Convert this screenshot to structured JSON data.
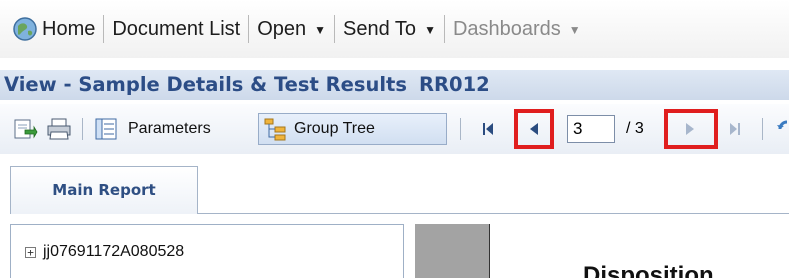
{
  "nav": {
    "home": "Home",
    "document_list": "Document List",
    "open": "Open",
    "send_to": "Send To",
    "dashboards": "Dashboards"
  },
  "view": {
    "title": "View - Sample Details & Test Results",
    "code": "RR012"
  },
  "toolbar": {
    "parameters": "Parameters",
    "group_tree": "Group Tree",
    "current_page": "3",
    "total_pages": "/ 3"
  },
  "tabs": {
    "main_report": "Main Report"
  },
  "tree": {
    "item": "jj07691172A080528"
  },
  "report": {
    "partial_heading": "Disposition"
  },
  "colors": {
    "highlight": "#e01e1e",
    "title_text": "#2c4d86"
  }
}
